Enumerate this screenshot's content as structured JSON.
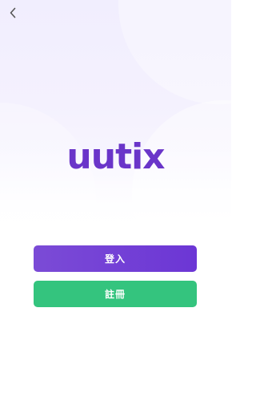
{
  "header": {
    "back_icon": "chevron-left-icon"
  },
  "brand": {
    "logo_text": "uutix",
    "logo_color": "#6a35c9"
  },
  "actions": {
    "login_label": "登入",
    "register_label": "註冊",
    "login_color": "#6c36d5",
    "register_color": "#34c47e"
  }
}
